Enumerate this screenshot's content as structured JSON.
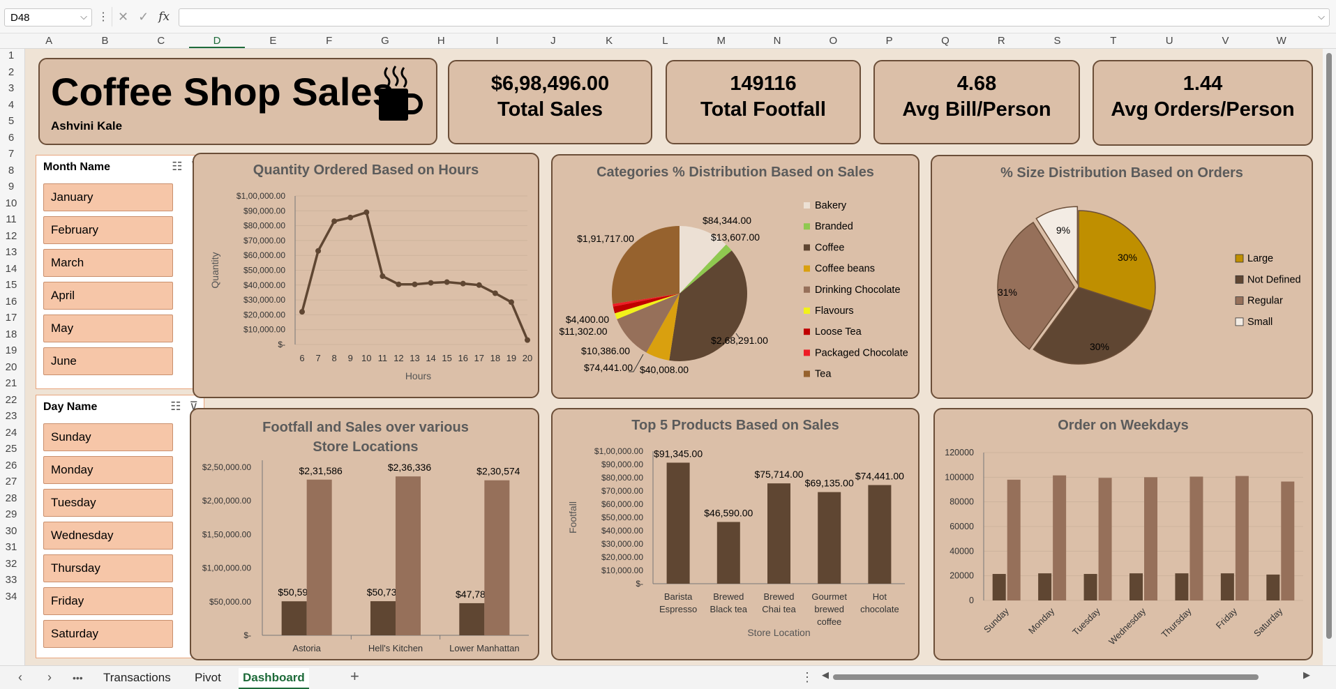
{
  "formula_bar": {
    "name_box": "D48",
    "fx": "fx",
    "formula_value": ""
  },
  "columns": [
    "A",
    "B",
    "C",
    "D",
    "E",
    "F",
    "G",
    "H",
    "I",
    "J",
    "K",
    "L",
    "M",
    "N",
    "O",
    "P",
    "Q",
    "R",
    "S",
    "T",
    "U",
    "V",
    "W"
  ],
  "active_column": "D",
  "rows": [
    "1",
    "2",
    "3",
    "4",
    "5",
    "6",
    "7",
    "8",
    "9",
    "10",
    "11",
    "12",
    "13",
    "14",
    "15",
    "16",
    "17",
    "18",
    "19",
    "20",
    "21",
    "22",
    "23",
    "24",
    "25",
    "26",
    "27",
    "28",
    "29",
    "30",
    "31",
    "32",
    "33",
    "34"
  ],
  "title_card": {
    "title": "Coffee Shop Sales",
    "author": "Ashvini Kale"
  },
  "kpis": [
    {
      "value": "$6,98,496.00",
      "label": "Total  Sales"
    },
    {
      "value": "149116",
      "label": "Total Footfall"
    },
    {
      "value": "4.68",
      "label": "Avg Bill/Person"
    },
    {
      "value": "1.44",
      "label": "Avg Orders/Person"
    }
  ],
  "month_slicer": {
    "header": "Month Name",
    "items": [
      "January",
      "February",
      "March",
      "April",
      "May",
      "June"
    ]
  },
  "day_slicer": {
    "header": "Day Name",
    "items": [
      "Sunday",
      "Monday",
      "Tuesday",
      "Wednesday",
      "Thursday",
      "Friday",
      "Saturday"
    ]
  },
  "colors": {
    "dark_brown": "#5f4632",
    "mid_brown": "#96705a",
    "card_bg": "#dbbfa8",
    "canvas_bg": "#efe3d5",
    "gold": "#bf8f00"
  },
  "chart_data": [
    {
      "id": "hours",
      "type": "line",
      "title": "Quantity Ordered Based on Hours",
      "xlabel": "Hours",
      "ylabel": "Quantity",
      "x": [
        "6",
        "7",
        "8",
        "9",
        "10",
        "11",
        "12",
        "13",
        "14",
        "15",
        "16",
        "17",
        "18",
        "19",
        "20"
      ],
      "values": [
        22000,
        63000,
        83000,
        85500,
        89000,
        46000,
        40500,
        40500,
        41500,
        42000,
        41000,
        40000,
        34500,
        28500,
        3000
      ],
      "ylim": [
        0,
        100000
      ],
      "yticks": [
        "$-",
        "$10,000.00",
        "$20,000.00",
        "$30,000.00",
        "$40,000.00",
        "$50,000.00",
        "$60,000.00",
        "$70,000.00",
        "$80,000.00",
        "$90,000.00",
        "$1,00,000.00"
      ]
    },
    {
      "id": "categories",
      "type": "pie",
      "title": "Categories % Distribution Based on Sales",
      "categories": [
        "Bakery",
        "Branded",
        "Coffee",
        "Coffee beans",
        "Drinking Chocolate",
        "Flavours",
        "Loose Tea",
        "Packaged Chocolate",
        "Tea"
      ],
      "values": [
        84344,
        13607,
        268291,
        40008,
        74441,
        10386,
        11302,
        4400,
        191717
      ],
      "labels": [
        "$84,344.00",
        "$13,607.00",
        "$2,68,291.00",
        "$40,008.00",
        "$74,441.00",
        "$10,386.00",
        "$11,302.00",
        "$4,400.00",
        "$1,91,717.00"
      ],
      "colors": [
        "#ece0d4",
        "#8fc950",
        "#5f4632",
        "#d9a00f",
        "#96705a",
        "#f2f21a",
        "#c00000",
        "#ee1c25",
        "#96622e"
      ],
      "legend": "right"
    },
    {
      "id": "size",
      "type": "pie",
      "title": "% Size Distribution Based on Orders",
      "categories": [
        "Large",
        "Not Defined",
        "Regular",
        "Small"
      ],
      "values": [
        30,
        30,
        31,
        9
      ],
      "labels": [
        "30%",
        "30%",
        "31%",
        "9%"
      ],
      "colors": [
        "#bf8f00",
        "#5f4632",
        "#96705a",
        "#f3ece4"
      ],
      "legend": "right"
    },
    {
      "id": "footfall",
      "type": "bar",
      "title": "Footfall and Sales over various Store Locations",
      "categories": [
        "Astoria",
        "Hell's Kitchen",
        "Lower Manhattan"
      ],
      "series": [
        {
          "values": [
            50599,
            50735,
            47782
          ],
          "labels": [
            "$50,599",
            "$50,735",
            "$47,782"
          ]
        },
        {
          "values": [
            231586,
            236336,
            230574
          ],
          "labels": [
            "$2,31,586",
            "$2,36,336",
            "$2,30,574"
          ]
        }
      ],
      "ylim": [
        0,
        250000
      ],
      "yticks": [
        "$-",
        "$50,000.00",
        "$1,00,000.00",
        "$1,50,000.00",
        "$2,00,000.00",
        "$2,50,000.00"
      ]
    },
    {
      "id": "top5",
      "type": "bar",
      "title": "Top 5 Products Based on Sales",
      "xlabel": "Store Location",
      "ylabel": "Footfall",
      "categories": [
        "Barista Espresso",
        "Brewed Black tea",
        "Brewed Chai tea",
        "Gourmet brewed coffee",
        "Hot chocolate"
      ],
      "category_lines": [
        [
          "Barista",
          "Espresso"
        ],
        [
          "Brewed",
          "Black tea"
        ],
        [
          "Brewed",
          "Chai tea"
        ],
        [
          "Gourmet",
          "brewed",
          "coffee"
        ],
        [
          "Hot",
          "chocolate"
        ]
      ],
      "values": [
        91345,
        46590,
        75714,
        69135,
        74441
      ],
      "labels": [
        "$91,345.00",
        "$46,590.00",
        "$75,714.00",
        "$69,135.00",
        "$74,441.00"
      ],
      "ylim": [
        0,
        100000
      ],
      "yticks": [
        "$-",
        "$10,000.00",
        "$20,000.00",
        "$30,000.00",
        "$40,000.00",
        "$50,000.00",
        "$60,000.00",
        "$70,000.00",
        "$80,000.00",
        "$90,000.00",
        "$1,00,000.00"
      ]
    },
    {
      "id": "weekdays",
      "type": "bar",
      "title": "Order on Weekdays",
      "categories": [
        "Sunday",
        "Monday",
        "Tuesday",
        "Wednesday",
        "Thursday",
        "Friday",
        "Saturday"
      ],
      "series": [
        {
          "values": [
            21500,
            22000,
            21500,
            22000,
            22000,
            22000,
            21000
          ]
        },
        {
          "values": [
            98000,
            101500,
            99500,
            100000,
            100500,
            101000,
            96500
          ]
        }
      ],
      "ylim": [
        0,
        120000
      ],
      "yticks": [
        "0",
        "20000",
        "40000",
        "60000",
        "80000",
        "100000",
        "120000"
      ]
    }
  ],
  "sheet_tabs": {
    "more": "•••",
    "tabs": [
      "Transactions",
      "Pivot",
      "Dashboard"
    ],
    "active": "Dashboard",
    "add": "+"
  }
}
